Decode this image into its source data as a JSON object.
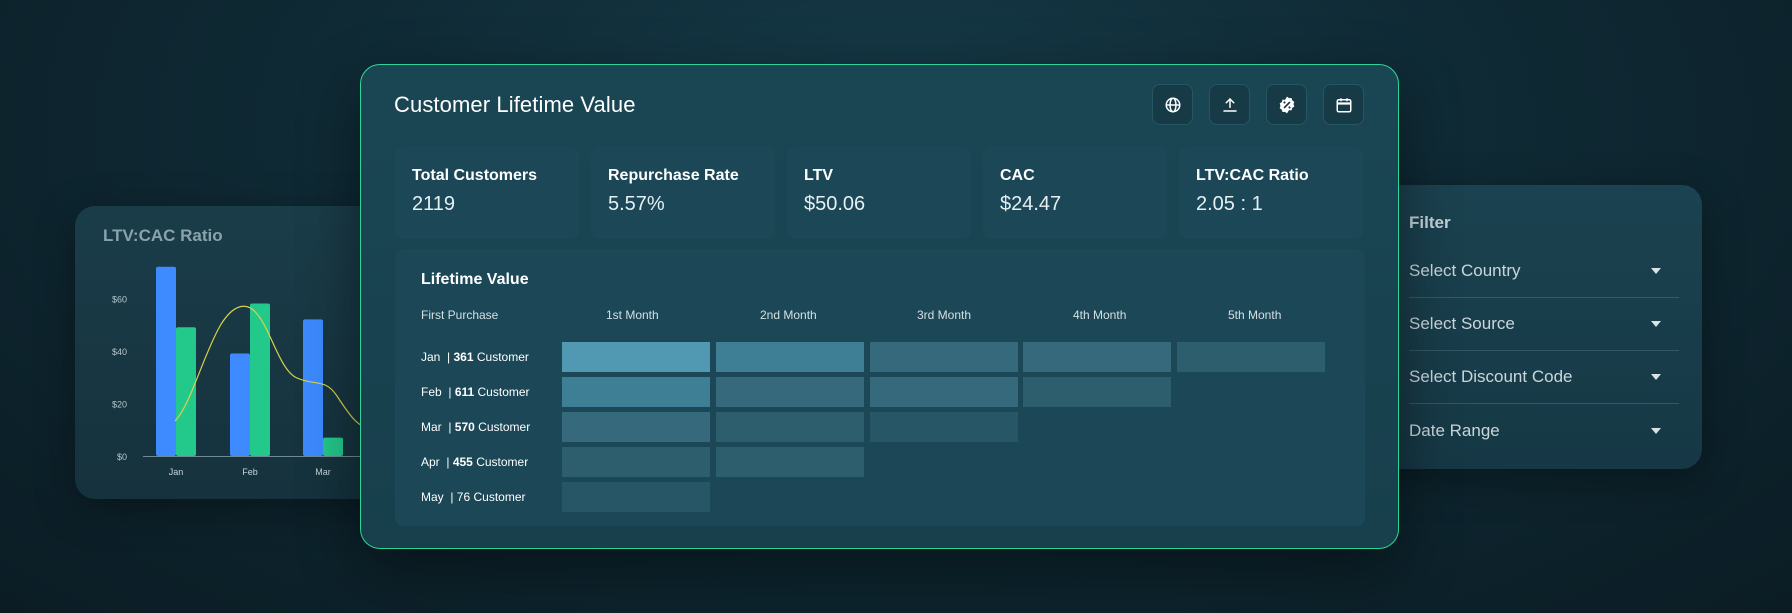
{
  "chart_card": {
    "title": "LTV:CAC Ratio",
    "y_ticks": [
      "$0",
      "$20",
      "$40",
      "$60"
    ]
  },
  "chart_data": {
    "type": "bar",
    "title": "LTV:CAC Ratio",
    "categories": [
      "Jan",
      "Feb",
      "Mar"
    ],
    "series": [
      {
        "values": [
          72,
          39,
          52
        ],
        "color": "#3d8bff"
      },
      {
        "values": [
          49,
          58,
          7
        ],
        "color": "#22c98b"
      }
    ],
    "ylim": [
      0,
      70
    ],
    "y_ticks": [
      0,
      20,
      40,
      60
    ],
    "y_tick_labels": [
      "$0",
      "$20",
      "$40",
      "$60"
    ],
    "overlay_line_color": "#d9d24a",
    "grid": false
  },
  "main": {
    "title": "Customer Lifetime Value",
    "toolbar_icons": [
      "globe-icon",
      "upload-icon",
      "discount-badge-icon",
      "calendar-icon"
    ],
    "kpis": [
      {
        "label": "Total Customers",
        "value": "2119"
      },
      {
        "label": "Repurchase Rate",
        "value": "5.57%"
      },
      {
        "label": "LTV",
        "value": "$50.06"
      },
      {
        "label": "CAC",
        "value": "$24.47"
      },
      {
        "label": "LTV:CAC Ratio",
        "value": "2.05 : 1"
      }
    ]
  },
  "lifetime": {
    "title": "Lifetime Value",
    "first_col": "First Purchase",
    "months": [
      "1st Month",
      "2nd Month",
      "3rd Month",
      "4th Month",
      "5th Month"
    ],
    "rows": [
      {
        "month": "Jan",
        "count": "361",
        "suffix": "Customer",
        "levels": [
          5,
          4,
          3,
          3,
          2
        ]
      },
      {
        "month": "Feb",
        "count": "611",
        "suffix": "Customer",
        "levels": [
          4,
          3,
          3,
          2
        ]
      },
      {
        "month": "Mar",
        "count": "570",
        "suffix": "Customer",
        "levels": [
          3,
          2,
          1
        ]
      },
      {
        "month": "Apr",
        "count": "455",
        "suffix": "Customer",
        "levels": [
          2,
          2
        ]
      },
      {
        "month": "May",
        "count": "76",
        "suffix": "Customer",
        "levels": [
          1
        ]
      }
    ],
    "level_colors": [
      "#1b4757",
      "#275766",
      "#2d5e6e",
      "#36697b",
      "#3f7f95",
      "#5199b2"
    ]
  },
  "filter": {
    "title": "Filter",
    "options": [
      "Select Country",
      "Select Source",
      "Select Discount Code",
      "Date Range"
    ]
  }
}
